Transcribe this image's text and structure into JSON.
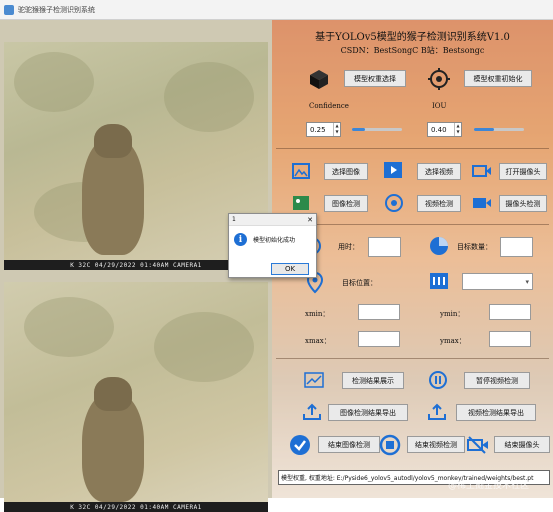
{
  "window": {
    "title": "驼驼猴猴子检测识别系统"
  },
  "video": {
    "overlay_text_top": "K 32C  04/29/2022  01:40AM  CAMERA1",
    "overlay_text_bottom": "K 32C  04/29/2022  01:40AM  CAMERA1"
  },
  "header": {
    "title": "基于YOLOv5模型的猴子检测识别系统V1.0",
    "subtitle": "CSDN：BestSongC   B站：Bestsongc"
  },
  "model": {
    "select_label": "模型权重选择",
    "init_label": "模型权重初始化",
    "confidence_label": "Confidence",
    "iou_label": "IOU",
    "confidence_value": "0.25",
    "iou_value": "0.40",
    "confidence_level": 0.25,
    "iou_level": 0.4
  },
  "input": {
    "select_image": "选择图像",
    "select_video": "选择视频",
    "open_camera": "打开摄像头",
    "image_detect": "图像检测",
    "video_detect": "视频检测",
    "camera_detect": "摄像头检测"
  },
  "stats": {
    "time_label": "用时：",
    "count_label": "目标数量：",
    "position_label": "目标位置：",
    "xmin_label": "xmin：",
    "ymin_label": "ymin：",
    "xmax_label": "xmax：",
    "ymax_label": "ymax："
  },
  "actions": {
    "show_results": "检测结果展示",
    "pause_video": "暂停视频检测",
    "export_image": "图像检测结果导出",
    "export_video": "视频检测结果导出",
    "end_image": "结束图像检测",
    "end_video": "结束视频检测",
    "end_camera": "结束摄像头"
  },
  "status": {
    "text": "模型权重, 权重地址: E:/Pyside6_yolov5_autodl/yolov5_monkey/trained/weights/best.pt"
  },
  "watermark": "@稀土掘金技术社区",
  "dialog": {
    "title": "1",
    "message": "模型初始化成功",
    "ok": "OK"
  },
  "colors": {
    "accent": "#1e6fd4",
    "autumn": "#d7792f"
  }
}
